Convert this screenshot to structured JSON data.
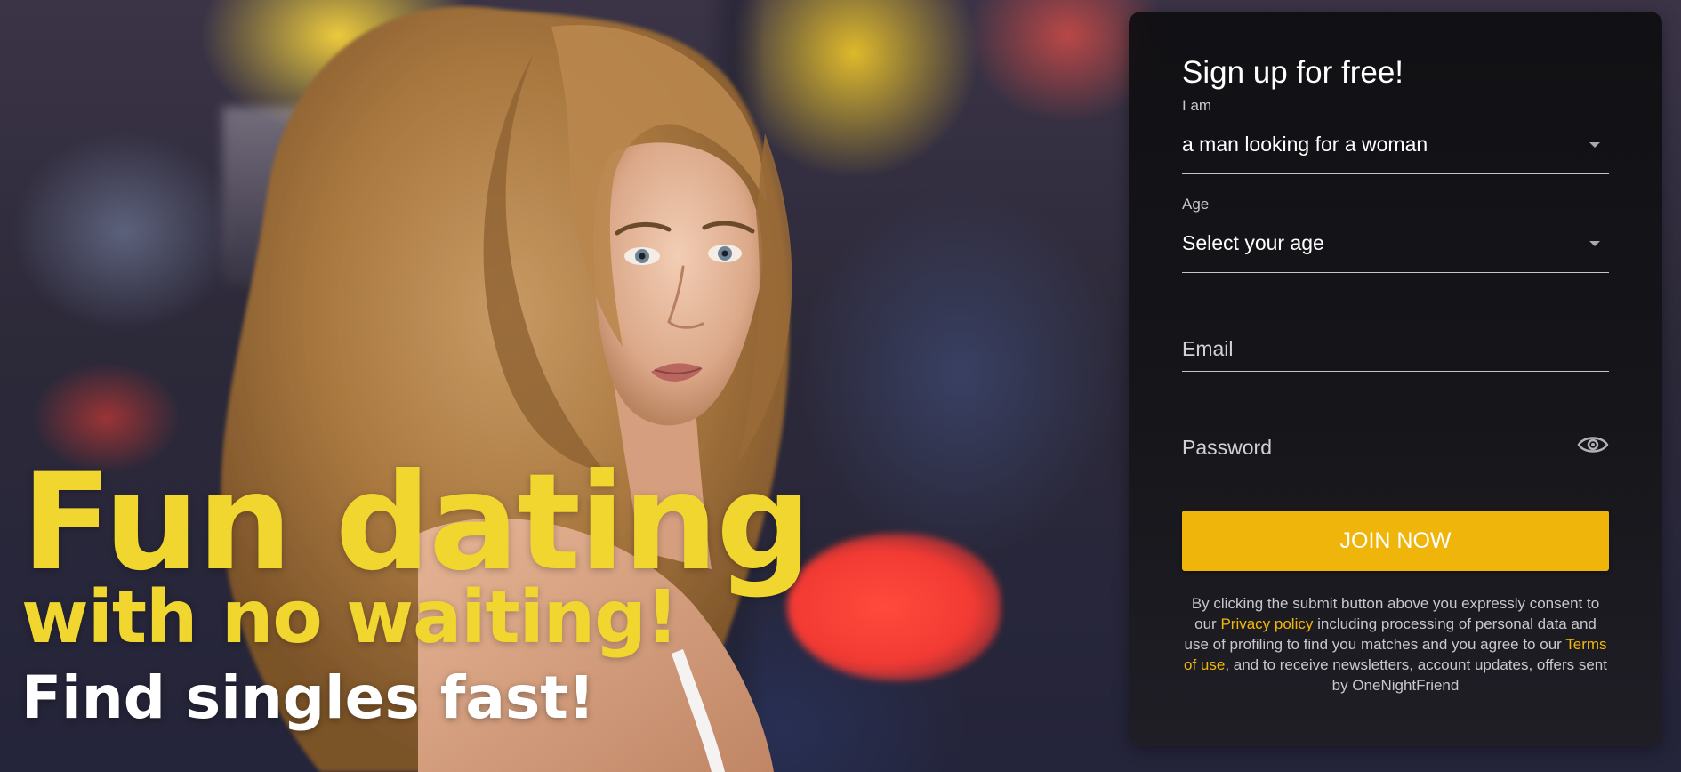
{
  "hero": {
    "headline_line1": "Fun dating",
    "headline_line2": "with no waiting!",
    "headline_line3": "Find singles fast!",
    "headline_color": "#f0d62e"
  },
  "signup": {
    "title": "Sign up for free!",
    "iam_label": "I am",
    "iam_value": "a man looking for a woman",
    "age_label": "Age",
    "age_value": "Select your age",
    "email_placeholder": "Email",
    "password_placeholder": "Password",
    "password_icon": "eye-icon",
    "dropdown_icon": "caret-down-icon",
    "join_label": "JOIN NOW",
    "join_color": "#efb50a",
    "consent": {
      "part1": "By clicking the submit button above you expressly consent to our ",
      "privacy_link": "Privacy policy",
      "part2": " including processing of personal data and use of profiling to find you matches and you agree to our ",
      "terms_link": "Terms of use",
      "part3": ", and to receive newsletters, account updates, offers sent by OneNightFriend",
      "link_color": "#f2b70c"
    }
  }
}
